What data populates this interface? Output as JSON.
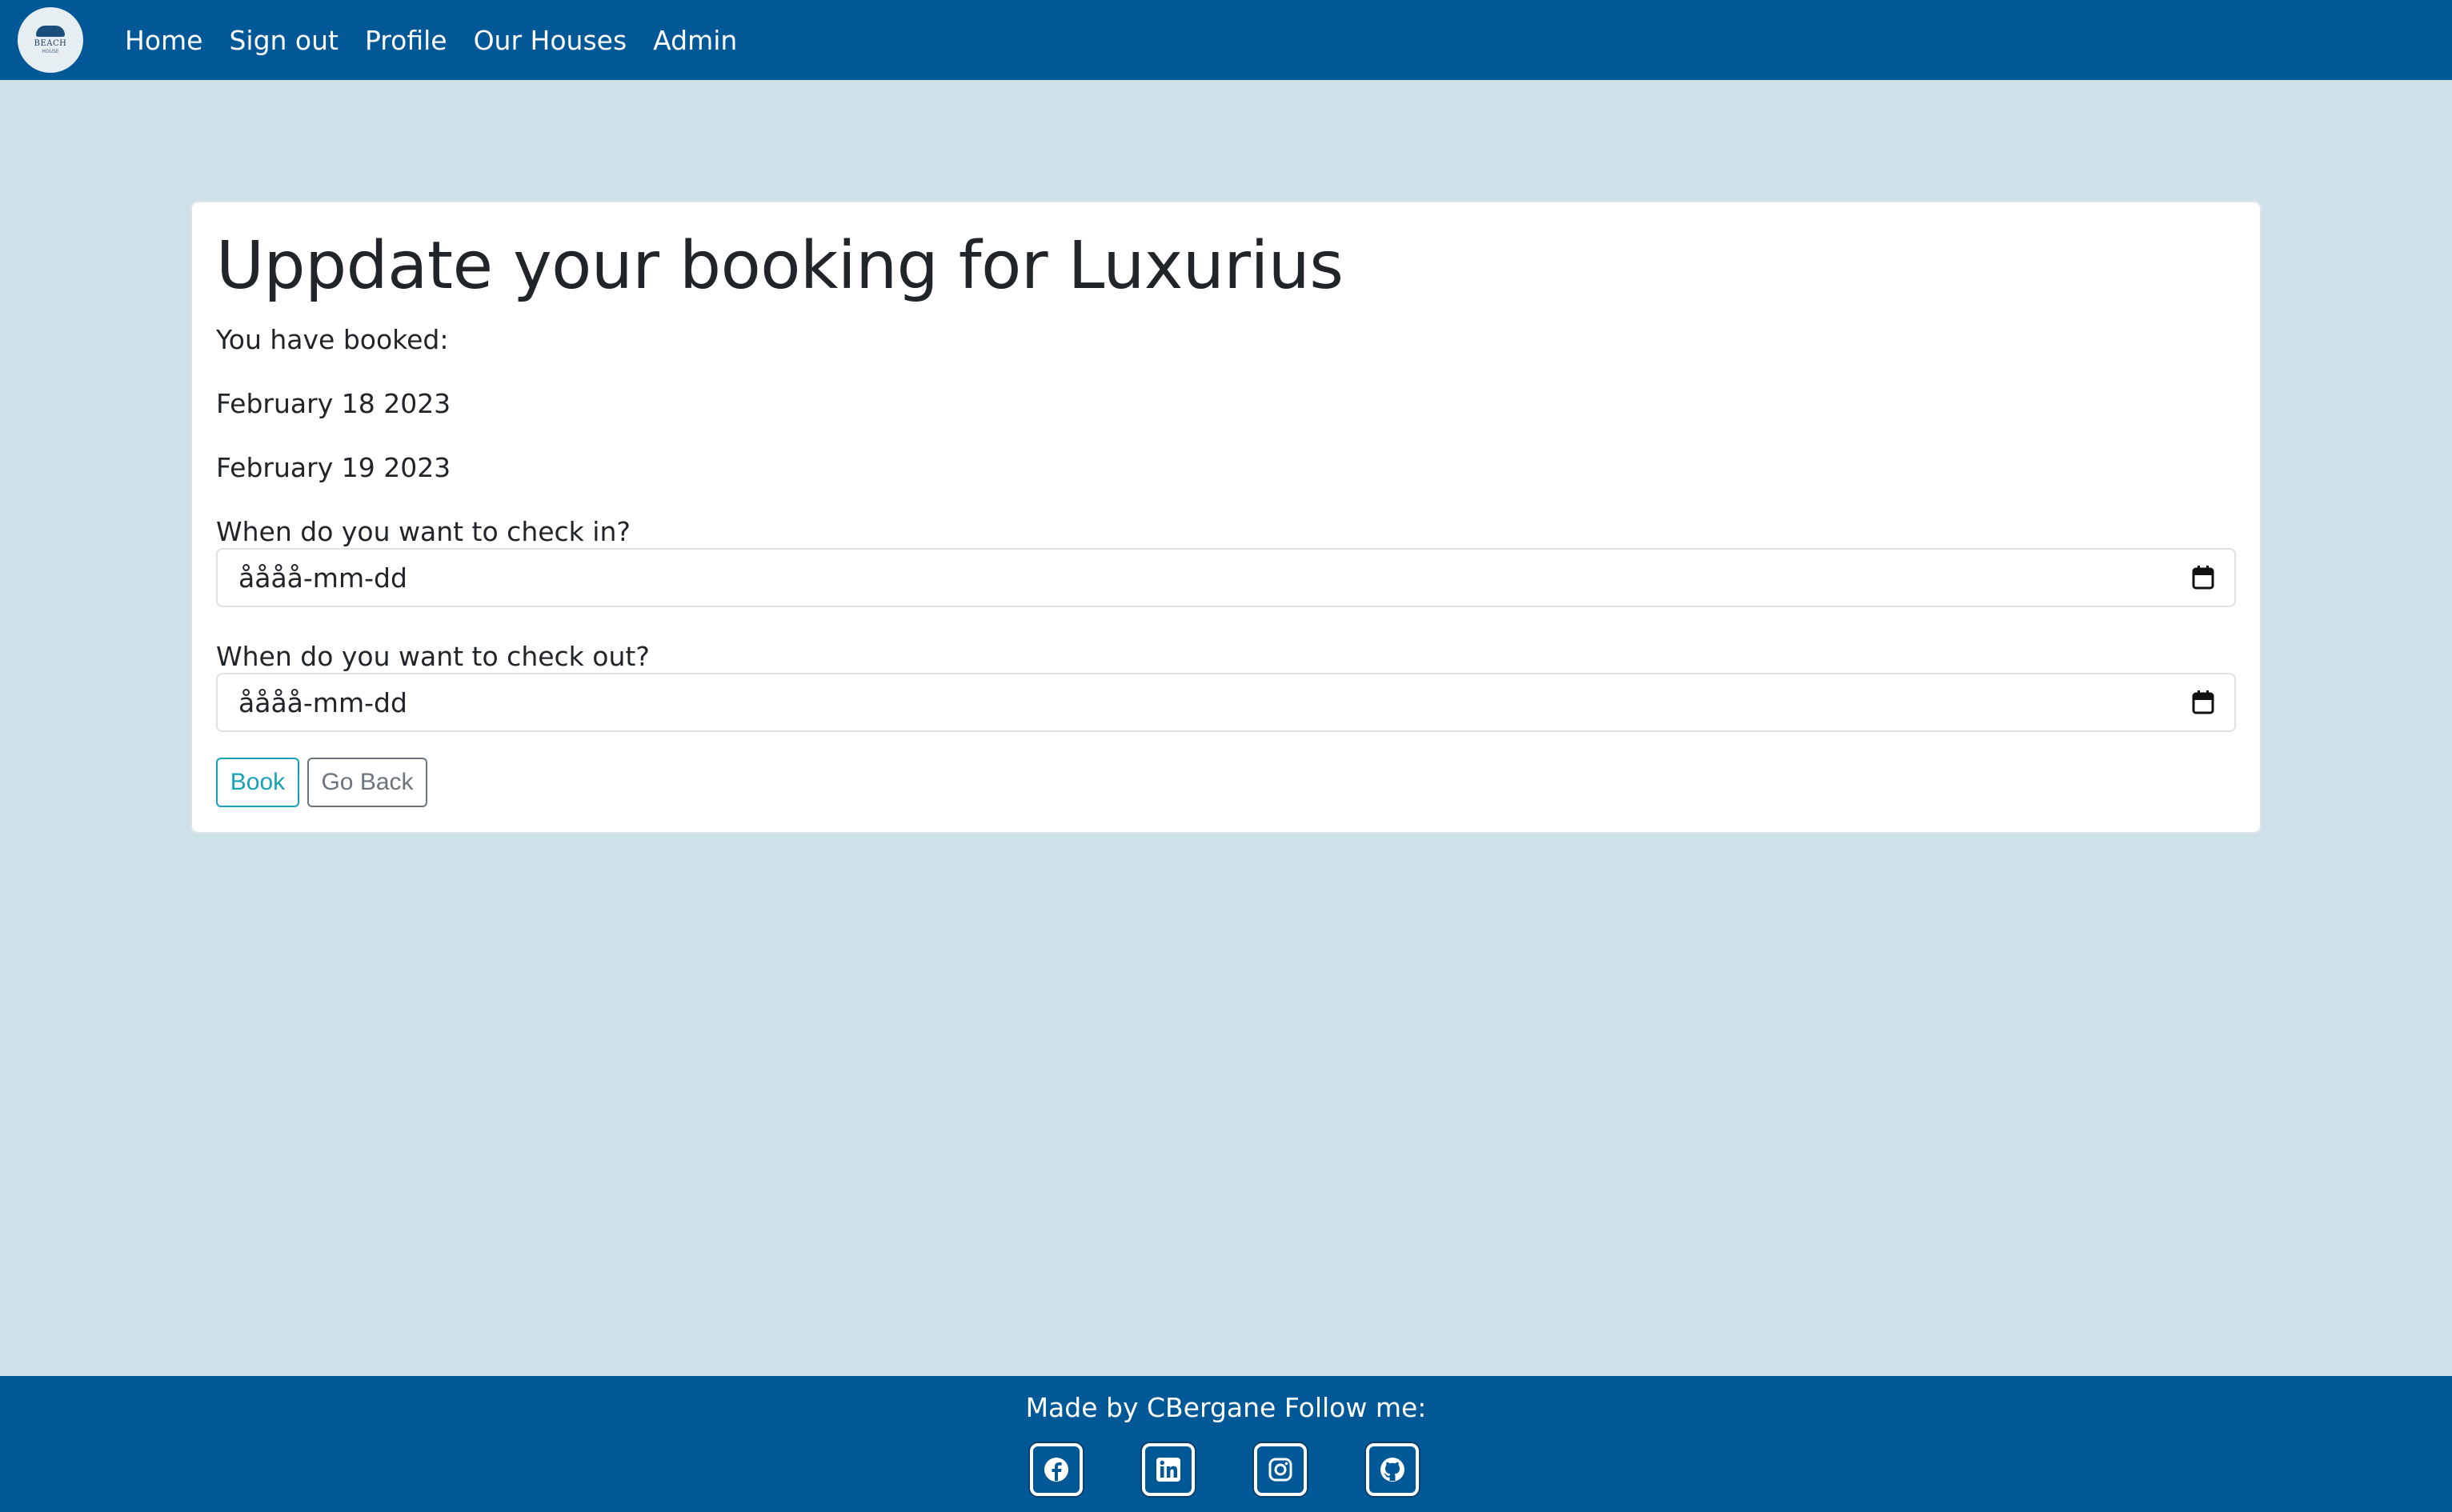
{
  "nav": {
    "logo": {
      "brand": "BEACH",
      "sub": "HOUSE"
    },
    "links": [
      "Home",
      "Sign out",
      "Profile",
      "Our Houses",
      "Admin"
    ]
  },
  "booking": {
    "title": "Uppdate your booking for Luxurius",
    "booked_label": "You have booked:",
    "booked_from": "February 18 2023",
    "booked_to": "February 19 2023",
    "checkin_label": "When do you want to check in?",
    "checkin_value": "åååå-mm-dd",
    "checkout_label": "When do you want to check out?",
    "checkout_value": "åååå-mm-dd",
    "book_button": "Book",
    "back_button": "Go Back"
  },
  "footer": {
    "text": "Made by CBergane Follow me:",
    "socials": [
      "facebook-icon",
      "linkedin-icon",
      "instagram-icon",
      "github-icon"
    ]
  },
  "colors": {
    "navbar": "#005896",
    "background": "#cfe1e8",
    "book_button": "#17a2b8",
    "back_button": "#6c757d"
  }
}
